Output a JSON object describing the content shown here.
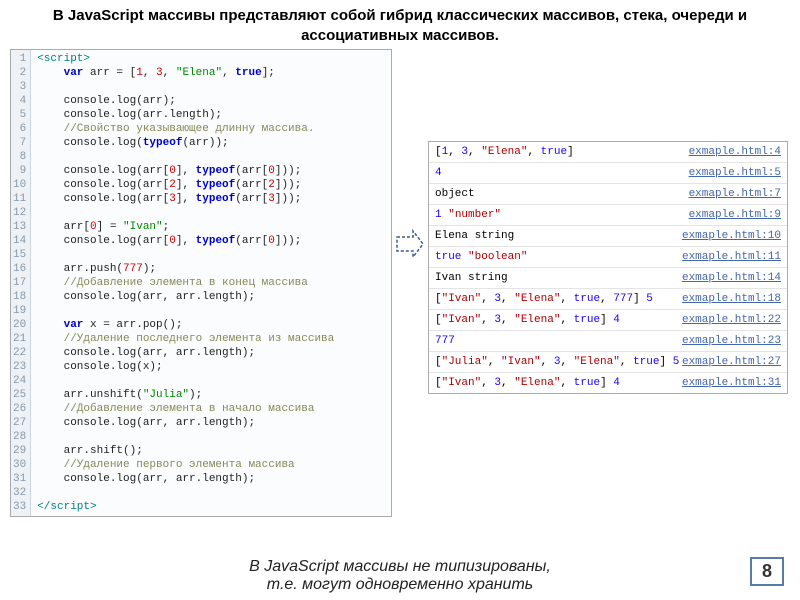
{
  "title": "В JavaScript массивы представляют собой гибрид классических массивов, стека, очереди и ассоциативных массивов.",
  "footer_line1": "В JavaScript массивы не типизированы,",
  "footer_line2": "т.е. могут одновременно хранить",
  "page_number": "8",
  "code_lines": [
    "<script>",
    "    var arr = [1, 3, \"Elena\", true];",
    "",
    "    console.log(arr);",
    "    console.log(arr.length);",
    "    //Свойство указывающее длинну массива.",
    "    console.log(typeof(arr));",
    "",
    "    console.log(arr[0], typeof(arr[0]));",
    "    console.log(arr[2], typeof(arr[2]));",
    "    console.log(arr[3], typeof(arr[3]));",
    "",
    "    arr[0] = \"Ivan\";",
    "    console.log(arr[0], typeof(arr[0]));",
    "",
    "    arr.push(777);",
    "    //Добавление элемента в конец массива",
    "    console.log(arr, arr.length);",
    "",
    "    var x = arr.pop();",
    "    //Удаление последнего элемента из массива",
    "    console.log(arr, arr.length);",
    "    console.log(x);",
    "",
    "    arr.unshift(\"Julia\");",
    "    //Добавление элемента в начало массива",
    "    console.log(arr, arr.length);",
    "",
    "    arr.shift();",
    "    //Удаление первого элемента массива",
    "    console.log(arr, arr.length);",
    "",
    "</script>"
  ],
  "console_rows": [
    {
      "html": "[<span class='cnum'>1</span>, <span class='cnum'>3</span>, <span class='cstr'>\"Elena\"</span>, <span class='cbool'>true</span>]",
      "src": "exmaple.html:4"
    },
    {
      "html": "<span class='cnum'>4</span>",
      "src": "exmaple.html:5"
    },
    {
      "html": "object",
      "src": "exmaple.html:7"
    },
    {
      "html": "<span class='cnum'>1</span> <span class='cstr'>\"number\"</span>",
      "src": "exmaple.html:9"
    },
    {
      "html": "Elena string",
      "src": "exmaple.html:10"
    },
    {
      "html": "<span class='cbool'>true</span> <span class='cstr'>\"boolean\"</span>",
      "src": "exmaple.html:11"
    },
    {
      "html": "Ivan string",
      "src": "exmaple.html:14"
    },
    {
      "html": "[<span class='cstr'>\"Ivan\"</span>, <span class='cnum'>3</span>, <span class='cstr'>\"Elena\"</span>, <span class='cbool'>true</span>, <span class='cnum'>777</span>] <span class='cnum'>5</span>",
      "src": "exmaple.html:18"
    },
    {
      "html": "[<span class='cstr'>\"Ivan\"</span>, <span class='cnum'>3</span>, <span class='cstr'>\"Elena\"</span>, <span class='cbool'>true</span>] <span class='cnum'>4</span>",
      "src": "exmaple.html:22"
    },
    {
      "html": "<span class='cnum'>777</span>",
      "src": "exmaple.html:23"
    },
    {
      "html": "[<span class='cstr'>\"Julia\"</span>, <span class='cstr'>\"Ivan\"</span>, <span class='cnum'>3</span>, <span class='cstr'>\"Elena\"</span>, <span class='cbool'>true</span>] <span class='cnum'>5</span>",
      "src": "exmaple.html:27"
    },
    {
      "html": "[<span class='cstr'>\"Ivan\"</span>, <span class='cnum'>3</span>, <span class='cstr'>\"Elena\"</span>, <span class='cbool'>true</span>] <span class='cnum'>4</span>",
      "src": "exmaple.html:31"
    }
  ]
}
